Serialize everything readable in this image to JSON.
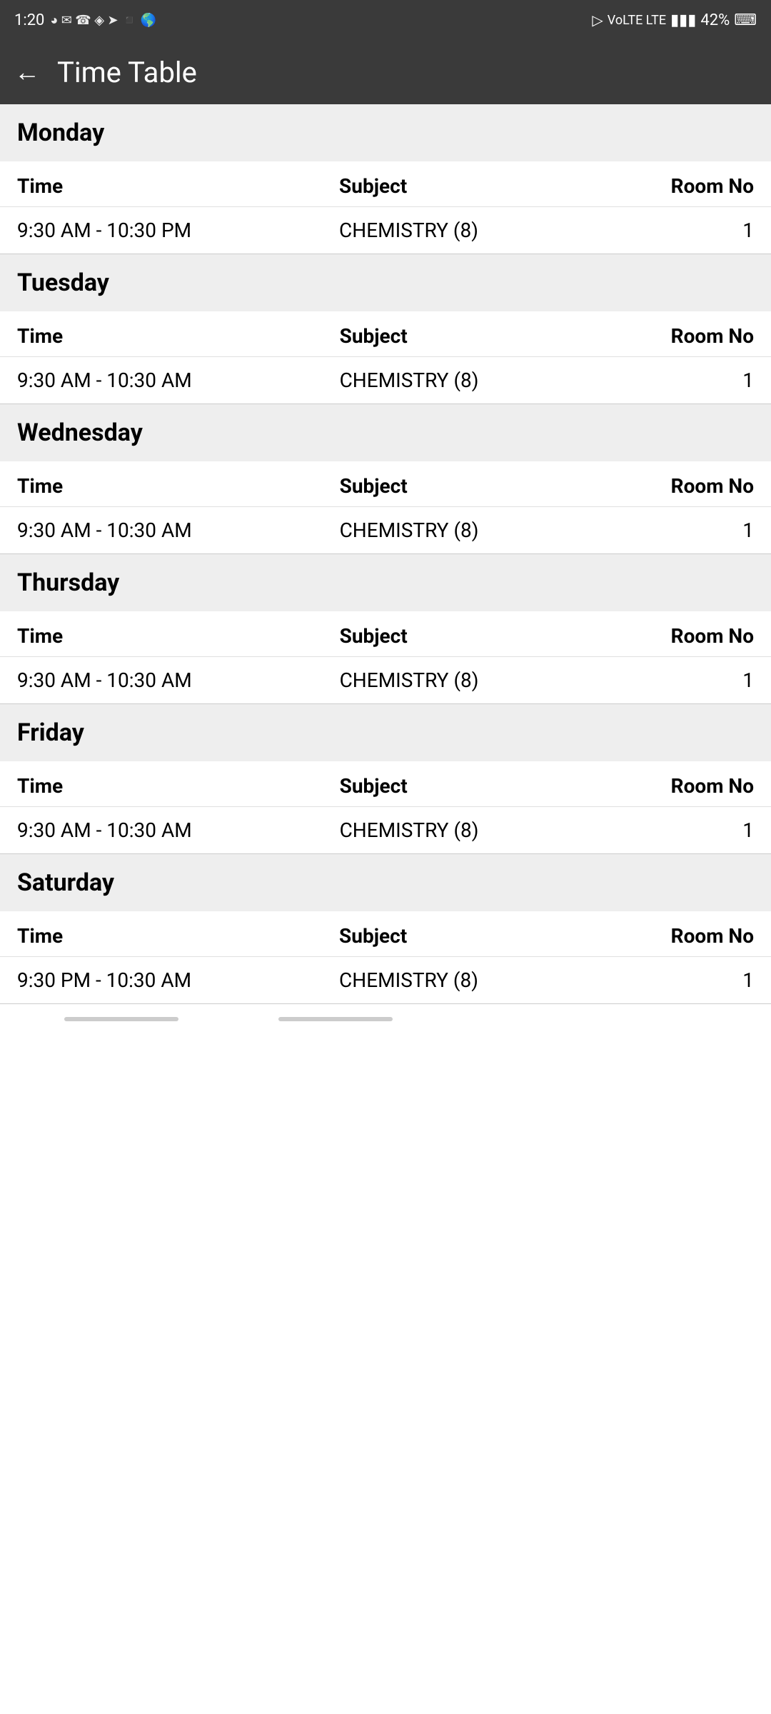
{
  "statusBar": {
    "time": "1:20",
    "battery": "42%"
  },
  "appBar": {
    "title": "Time Table",
    "backLabel": "←"
  },
  "columns": {
    "time": "Time",
    "subject": "Subject",
    "roomNo": "Room No"
  },
  "days": [
    {
      "name": "Monday",
      "entries": [
        {
          "time": "9:30 AM - 10:30 PM",
          "subject": "CHEMISTRY (8)",
          "room": "1"
        }
      ]
    },
    {
      "name": "Tuesday",
      "entries": [
        {
          "time": "9:30 AM - 10:30 AM",
          "subject": "CHEMISTRY (8)",
          "room": "1"
        }
      ]
    },
    {
      "name": "Wednesday",
      "entries": [
        {
          "time": "9:30 AM - 10:30 AM",
          "subject": "CHEMISTRY (8)",
          "room": "1"
        }
      ]
    },
    {
      "name": "Thursday",
      "entries": [
        {
          "time": "9:30 AM - 10:30 AM",
          "subject": "CHEMISTRY (8)",
          "room": "1"
        }
      ]
    },
    {
      "name": "Friday",
      "entries": [
        {
          "time": "9:30 AM - 10:30 AM",
          "subject": "CHEMISTRY (8)",
          "room": "1"
        }
      ]
    },
    {
      "name": "Saturday",
      "entries": [
        {
          "time": "9:30 PM - 10:30 AM",
          "subject": "CHEMISTRY (8)",
          "room": "1"
        }
      ]
    }
  ]
}
